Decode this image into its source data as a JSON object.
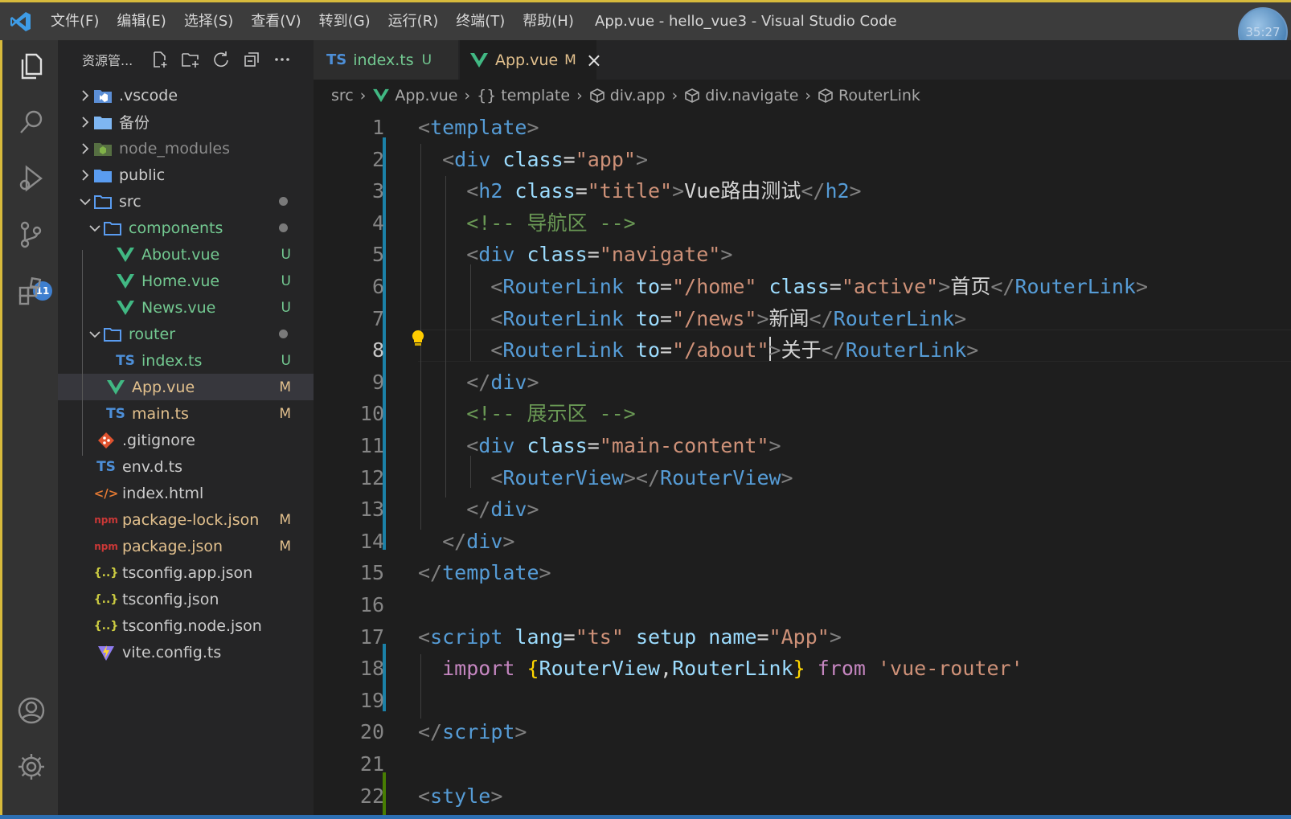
{
  "titlebar": {
    "menu": [
      "文件(F)",
      "编辑(E)",
      "选择(S)",
      "查看(V)",
      "转到(G)",
      "运行(R)",
      "终端(T)",
      "帮助(H)"
    ],
    "window_title": "App.vue - hello_vue3 - Visual Studio Code",
    "clock": "35:27"
  },
  "activity": {
    "source_control_badge": "11"
  },
  "explorer": {
    "title": "资源管...",
    "items": [
      {
        "label": ".vscode",
        "status": ""
      },
      {
        "label": "备份",
        "status": ""
      },
      {
        "label": "node_modules",
        "status": ""
      },
      {
        "label": "public",
        "status": ""
      },
      {
        "label": "src",
        "status": ""
      },
      {
        "label": "components",
        "status": ""
      },
      {
        "label": "About.vue",
        "status": "U"
      },
      {
        "label": "Home.vue",
        "status": "U"
      },
      {
        "label": "News.vue",
        "status": "U"
      },
      {
        "label": "router",
        "status": ""
      },
      {
        "label": "index.ts",
        "status": "U"
      },
      {
        "label": "App.vue",
        "status": "M"
      },
      {
        "label": "main.ts",
        "status": "M"
      },
      {
        "label": ".gitignore",
        "status": ""
      },
      {
        "label": "env.d.ts",
        "status": ""
      },
      {
        "label": "index.html",
        "status": ""
      },
      {
        "label": "package-lock.json",
        "status": "M"
      },
      {
        "label": "package.json",
        "status": "M"
      },
      {
        "label": "tsconfig.app.json",
        "status": ""
      },
      {
        "label": "tsconfig.json",
        "status": ""
      },
      {
        "label": "tsconfig.node.json",
        "status": ""
      },
      {
        "label": "vite.config.ts",
        "status": ""
      }
    ],
    "icon_ts": "TS",
    "icon_json": "{..}",
    "icon_html": "</>",
    "icon_npm": "npm"
  },
  "tabs": [
    {
      "label": "index.ts",
      "icon": "TS",
      "status": "U"
    },
    {
      "label": "App.vue",
      "status": "M",
      "close": "×"
    }
  ],
  "breadcrumb": [
    "src",
    "App.vue",
    "template",
    "div.app",
    "div.navigate",
    "RouterLink"
  ],
  "breadcrumb_braces": "{}",
  "editor": {
    "line_numbers": [
      "1",
      "2",
      "3",
      "4",
      "5",
      "6",
      "7",
      "8",
      "9",
      "10",
      "11",
      "12",
      "13",
      "14",
      "15",
      "16",
      "17",
      "18",
      "19",
      "20",
      "21",
      "22"
    ],
    "lines": [
      [
        {
          "t": "<",
          "c": "br"
        },
        {
          "t": "template",
          "c": "tag"
        },
        {
          "t": ">",
          "c": "br"
        }
      ],
      [
        {
          "t": "  <",
          "c": "br"
        },
        {
          "t": "div",
          "c": "tag"
        },
        {
          "t": " class",
          "c": "attr"
        },
        {
          "t": "=",
          "c": "text"
        },
        {
          "t": "\"app\"",
          "c": "str"
        },
        {
          "t": ">",
          "c": "br"
        }
      ],
      [
        {
          "t": "    <",
          "c": "br"
        },
        {
          "t": "h2",
          "c": "tag"
        },
        {
          "t": " class",
          "c": "attr"
        },
        {
          "t": "=",
          "c": "text"
        },
        {
          "t": "\"title\"",
          "c": "str"
        },
        {
          "t": ">",
          "c": "br"
        },
        {
          "t": "Vue路由测试",
          "c": "text"
        },
        {
          "t": "</",
          "c": "br"
        },
        {
          "t": "h2",
          "c": "tag"
        },
        {
          "t": ">",
          "c": "br"
        }
      ],
      [
        {
          "t": "    <!-- 导航区 -->",
          "c": "com"
        }
      ],
      [
        {
          "t": "    <",
          "c": "br"
        },
        {
          "t": "div",
          "c": "tag"
        },
        {
          "t": " class",
          "c": "attr"
        },
        {
          "t": "=",
          "c": "text"
        },
        {
          "t": "\"navigate\"",
          "c": "str"
        },
        {
          "t": ">",
          "c": "br"
        }
      ],
      [
        {
          "t": "      <",
          "c": "br"
        },
        {
          "t": "RouterLink",
          "c": "tag"
        },
        {
          "t": " to",
          "c": "attr"
        },
        {
          "t": "=",
          "c": "text"
        },
        {
          "t": "\"/home\"",
          "c": "str"
        },
        {
          "t": " class",
          "c": "attr"
        },
        {
          "t": "=",
          "c": "text"
        },
        {
          "t": "\"active\"",
          "c": "str"
        },
        {
          "t": ">",
          "c": "br"
        },
        {
          "t": "首页",
          "c": "text"
        },
        {
          "t": "</",
          "c": "br"
        },
        {
          "t": "RouterLink",
          "c": "tag"
        },
        {
          "t": ">",
          "c": "br"
        }
      ],
      [
        {
          "t": "      <",
          "c": "br"
        },
        {
          "t": "RouterLink",
          "c": "tag"
        },
        {
          "t": " to",
          "c": "attr"
        },
        {
          "t": "=",
          "c": "text"
        },
        {
          "t": "\"/news\"",
          "c": "str"
        },
        {
          "t": ">",
          "c": "br"
        },
        {
          "t": "新闻",
          "c": "text"
        },
        {
          "t": "</",
          "c": "br"
        },
        {
          "t": "RouterLink",
          "c": "tag"
        },
        {
          "t": ">",
          "c": "br"
        }
      ],
      [
        {
          "t": "      <",
          "c": "br"
        },
        {
          "t": "RouterLink",
          "c": "tag"
        },
        {
          "t": " to",
          "c": "attr"
        },
        {
          "t": "=",
          "c": "text"
        },
        {
          "t": "\"/about\"",
          "c": "str"
        },
        {
          "t": ">",
          "c": "br"
        },
        {
          "t": "关于",
          "c": "text"
        },
        {
          "t": "</",
          "c": "br"
        },
        {
          "t": "RouterLink",
          "c": "tag"
        },
        {
          "t": ">",
          "c": "br"
        }
      ],
      [
        {
          "t": "    </",
          "c": "br"
        },
        {
          "t": "div",
          "c": "tag"
        },
        {
          "t": ">",
          "c": "br"
        }
      ],
      [
        {
          "t": "    <!-- 展示区 -->",
          "c": "com"
        }
      ],
      [
        {
          "t": "    <",
          "c": "br"
        },
        {
          "t": "div",
          "c": "tag"
        },
        {
          "t": " class",
          "c": "attr"
        },
        {
          "t": "=",
          "c": "text"
        },
        {
          "t": "\"main-content\"",
          "c": "str"
        },
        {
          "t": ">",
          "c": "br"
        }
      ],
      [
        {
          "t": "      <",
          "c": "br"
        },
        {
          "t": "RouterView",
          "c": "tag"
        },
        {
          "t": "></",
          "c": "br"
        },
        {
          "t": "RouterView",
          "c": "tag"
        },
        {
          "t": ">",
          "c": "br"
        }
      ],
      [
        {
          "t": "    </",
          "c": "br"
        },
        {
          "t": "div",
          "c": "tag"
        },
        {
          "t": ">",
          "c": "br"
        }
      ],
      [
        {
          "t": "  </",
          "c": "br"
        },
        {
          "t": "div",
          "c": "tag"
        },
        {
          "t": ">",
          "c": "br"
        }
      ],
      [
        {
          "t": "</",
          "c": "br"
        },
        {
          "t": "template",
          "c": "tag"
        },
        {
          "t": ">",
          "c": "br"
        }
      ],
      [],
      [
        {
          "t": "<",
          "c": "br"
        },
        {
          "t": "script",
          "c": "tag"
        },
        {
          "t": " lang",
          "c": "attr"
        },
        {
          "t": "=",
          "c": "text"
        },
        {
          "t": "\"ts\"",
          "c": "str"
        },
        {
          "t": " setup",
          "c": "attr"
        },
        {
          "t": " name",
          "c": "attr"
        },
        {
          "t": "=",
          "c": "text"
        },
        {
          "t": "\"App\"",
          "c": "str"
        },
        {
          "t": ">",
          "c": "br"
        }
      ],
      [
        {
          "t": "  import ",
          "c": "kw"
        },
        {
          "t": "{",
          "c": "brace"
        },
        {
          "t": "RouterView",
          "c": "attr"
        },
        {
          "t": ",",
          "c": "text"
        },
        {
          "t": "RouterLink",
          "c": "attr"
        },
        {
          "t": "}",
          "c": "brace"
        },
        {
          "t": " from ",
          "c": "kw"
        },
        {
          "t": "'vue-router'",
          "c": "str"
        }
      ],
      [],
      [
        {
          "t": "</",
          "c": "br"
        },
        {
          "t": "script",
          "c": "tag"
        },
        {
          "t": ">",
          "c": "br"
        }
      ],
      [],
      [
        {
          "t": "<",
          "c": "br"
        },
        {
          "t": "style",
          "c": "tag"
        },
        {
          "t": ">",
          "c": "br"
        }
      ]
    ],
    "current_line": 8
  }
}
